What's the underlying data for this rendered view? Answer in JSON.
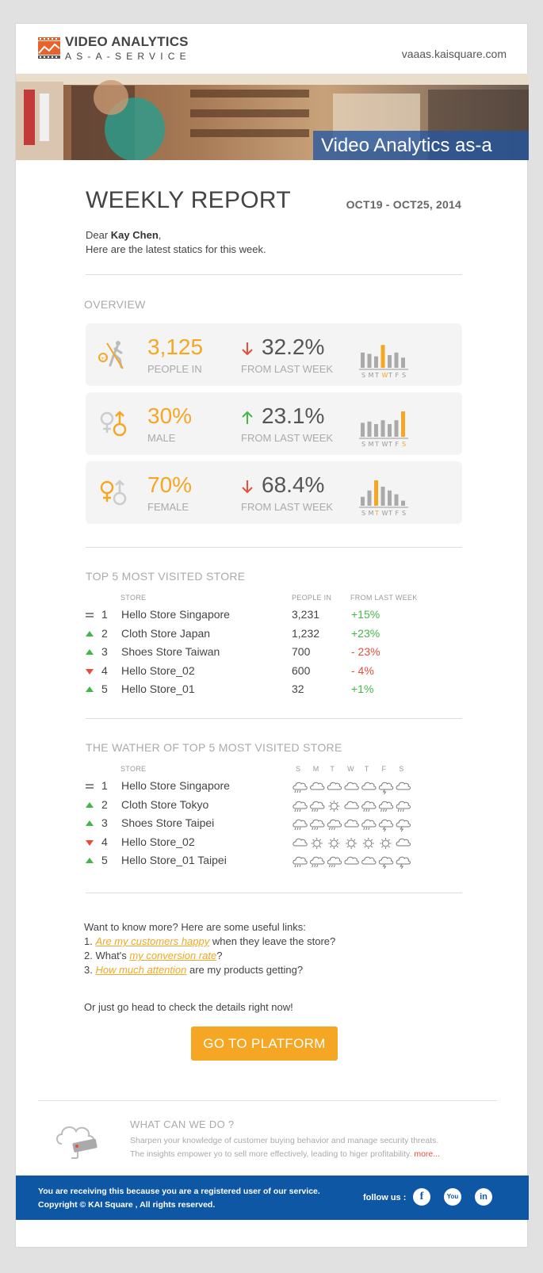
{
  "header": {
    "logo_line1": "VIDEO ANALYTICS",
    "logo_line2": "AS-A-SERVICE",
    "site_url": "vaaas.kaisquare.com"
  },
  "banner": {
    "caption": "Video Analytics as-a Service"
  },
  "report": {
    "title": "WEEKLY REPORT",
    "date_range": "OCT19 - OCT25, 2014",
    "greeting_prefix": "Dear ",
    "name": "Kay Chen",
    "greeting_suffix": ",",
    "intro": "Here are the latest statics for this week."
  },
  "overview": {
    "title": "OVERVIEW",
    "cards": [
      {
        "value": "3,125",
        "label": "PEOPLE IN",
        "pct": "32.2%",
        "direction": "down",
        "from": "FROM LAST WEEK",
        "days": "SMTWTFS",
        "highlight_day": 3,
        "bars": [
          0.6,
          0.55,
          0.45,
          0.9,
          0.5,
          0.6,
          0.4
        ]
      },
      {
        "value": "30%",
        "label": "MALE",
        "pct": "23.1%",
        "direction": "up",
        "from": "FROM LAST WEEK",
        "days": "SMTWTFS",
        "highlight_day": 6,
        "bars": [
          0.55,
          0.6,
          0.5,
          0.65,
          0.5,
          0.65,
          1.0
        ]
      },
      {
        "value": "70%",
        "label": "FEMALE",
        "pct": "68.4%",
        "direction": "down",
        "from": "FROM LAST WEEK",
        "days": "SMTWTFS",
        "highlight_day": 2,
        "bars": [
          0.35,
          0.6,
          1.0,
          0.75,
          0.6,
          0.45,
          0.2
        ]
      }
    ]
  },
  "top5": {
    "title": "TOP 5  MOST VISITED STORE",
    "col_store": "STORE",
    "col_people": "PEOPLE IN",
    "col_change": "FROM LAST WEEK",
    "rows": [
      {
        "trend": "same",
        "rank": "1",
        "store": "Hello Store Singapore",
        "people": "3,231",
        "change": "+15%",
        "positive": true
      },
      {
        "trend": "up",
        "rank": "2",
        "store": "Cloth Store Japan",
        "people": "1,232",
        "change": "+23%",
        "positive": true
      },
      {
        "trend": "up",
        "rank": "3",
        "store": "Shoes Store  Taiwan",
        "people": "700",
        "change": "- 23%",
        "positive": false
      },
      {
        "trend": "down",
        "rank": "4",
        "store": "Hello Store_02",
        "people": "600",
        "change": "- 4%",
        "positive": false
      },
      {
        "trend": "up",
        "rank": "5",
        "store": "Hello Store_01",
        "people": "32",
        "change": "+1%",
        "positive": true
      }
    ]
  },
  "weather": {
    "title": "THE WATHER OF TOP 5  MOST VISITED STORE",
    "col_store": "STORE",
    "days": [
      "S",
      "M",
      "T",
      "W",
      "T",
      "F",
      "S"
    ],
    "rows": [
      {
        "trend": "same",
        "rank": "1",
        "store": "Hello Store Singapore",
        "icons": [
          "rain",
          "cloud",
          "cloud",
          "cloud",
          "cloud",
          "storm",
          "cloud"
        ]
      },
      {
        "trend": "up",
        "rank": "2",
        "store": "Cloth Store Tokyo",
        "icons": [
          "rain",
          "rain",
          "sun",
          "cloud",
          "rain",
          "rain",
          "rain"
        ]
      },
      {
        "trend": "up",
        "rank": "3",
        "store": "Shoes Store Taipei",
        "icons": [
          "rain",
          "rain",
          "rain",
          "cloud",
          "rain",
          "storm",
          "storm"
        ]
      },
      {
        "trend": "down",
        "rank": "4",
        "store": "Hello Store_02",
        "icons": [
          "cloud",
          "sun",
          "sun",
          "sun",
          "sun",
          "sun",
          "cloud"
        ]
      },
      {
        "trend": "up",
        "rank": "5",
        "store": "Hello Store_01 Taipei",
        "icons": [
          "rain",
          "rain",
          "rain",
          "cloud",
          "cloud",
          "storm",
          "storm"
        ]
      }
    ]
  },
  "links": {
    "intro": "Want to know more? Here are some useful links:",
    "l1_num": "1. ",
    "l1_link": "Are my customers happy",
    "l1_rest": " when they leave the store?",
    "l2_num": "2. What's ",
    "l2_link": "my conversion rate",
    "l2_rest": "?",
    "l3_num": "3. ",
    "l3_link": "How much attention",
    "l3_rest": " are my products getting?",
    "closing": "Or just go head to check the details right now!"
  },
  "cta": {
    "label": "GO TO PLATFORM"
  },
  "what_can_we_do": {
    "title": "WHAT CAN WE DO ?",
    "line1": "Sharpen your knowledge of customer buying behavior and manage security threats.",
    "line2": "The insights empower yo to sell more effectively, leading to higer profitability. ",
    "more": "more..."
  },
  "footer": {
    "line1": "You are receiving this because you are a registered user of our service.",
    "line2_prefix": "Copyright © ",
    "line2_brand": "KAI Square",
    "line2_suffix": " , All rights reserved.",
    "follow": "follow us :",
    "social": [
      "facebook",
      "youtube",
      "linkedin"
    ],
    "youtube_text": "You"
  },
  "colors": {
    "accent": "#f5a623",
    "positive": "#43b649",
    "negative": "#e84c3d",
    "footer_bg": "#0d57a5",
    "banner_caption_bg": "#2256a0"
  }
}
